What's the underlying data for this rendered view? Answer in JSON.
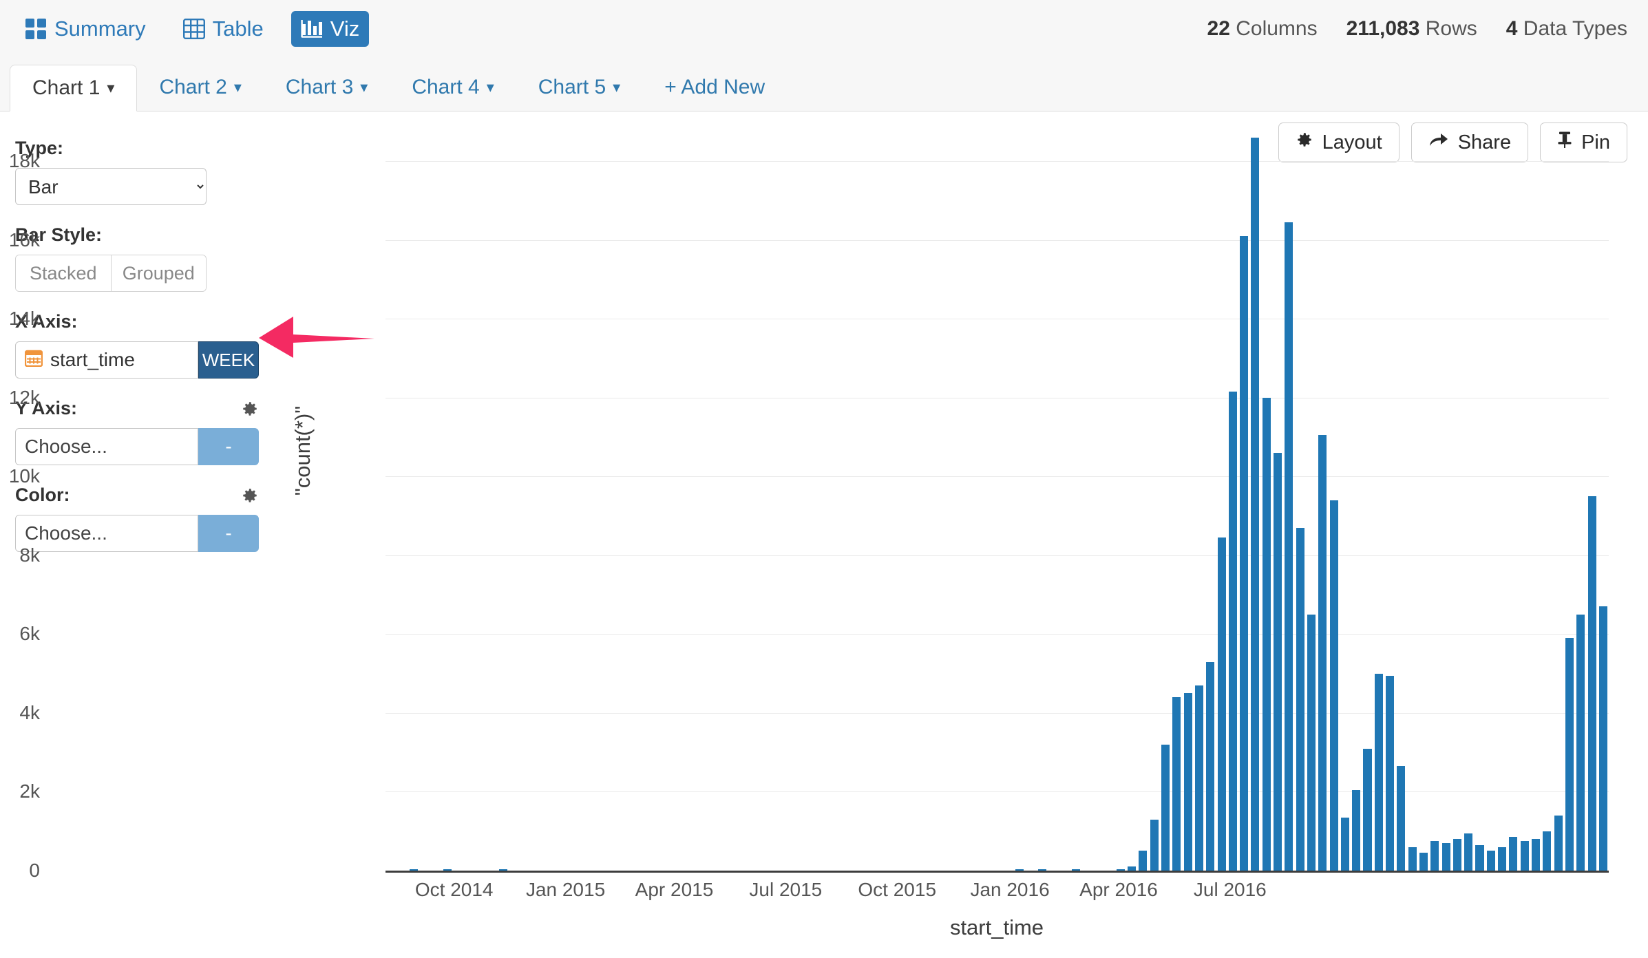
{
  "topbar": {
    "modes": [
      {
        "label": "Summary",
        "icon": "grid-icon",
        "active": false
      },
      {
        "label": "Table",
        "icon": "table-icon",
        "active": false
      },
      {
        "label": "Viz",
        "icon": "bar-chart-icon",
        "active": true
      }
    ],
    "stats": [
      {
        "value": "22",
        "label": "Columns"
      },
      {
        "value": "211,083",
        "label": "Rows"
      },
      {
        "value": "4",
        "label": "Data Types"
      }
    ]
  },
  "tabs": {
    "items": [
      {
        "label": "Chart 1",
        "active": true
      },
      {
        "label": "Chart 2",
        "active": false
      },
      {
        "label": "Chart 3",
        "active": false
      },
      {
        "label": "Chart 4",
        "active": false
      },
      {
        "label": "Chart 5",
        "active": false
      }
    ],
    "add_new_label": "+ Add New",
    "caret": "▾"
  },
  "panel": {
    "type_label": "Type:",
    "type_value": "Bar",
    "type_options": [
      "Bar"
    ],
    "bar_style_label": "Bar Style:",
    "bar_style_options": [
      "Stacked",
      "Grouped"
    ],
    "x_axis_label": "X Axis:",
    "x_axis_field": "start_time",
    "x_axis_field_icon": "calendar-icon",
    "x_axis_pill": "WEEK",
    "y_axis_label": "Y Axis:",
    "y_axis_field": "Choose...",
    "y_axis_pill": "-",
    "color_label": "Color:",
    "color_field": "Choose...",
    "color_pill": "-",
    "gear_icon": "gear-icon"
  },
  "actions": [
    {
      "label": "Layout",
      "icon": "gear-icon"
    },
    {
      "label": "Share",
      "icon": "share-arrow-icon"
    },
    {
      "label": "Pin",
      "icon": "pin-icon"
    }
  ],
  "annotation": {
    "type": "arrow",
    "direction": "left",
    "color": "#F42A62",
    "points_to": "x-axis-week-pill"
  },
  "colors": {
    "bar": "#1f77b4",
    "accent": "#2e7ab8",
    "pill_week": "#2a5f8f",
    "pill_dash": "#7aaed8",
    "annotation": "#F42A62"
  },
  "chart_data": {
    "type": "bar",
    "title": "",
    "xlabel": "start_time",
    "ylabel": "\"count(*)\"",
    "grid": true,
    "legend": null,
    "ylim": [
      0,
      18600
    ],
    "yticks": [
      0,
      2000,
      4000,
      6000,
      8000,
      10000,
      12000,
      14000,
      16000,
      18000
    ],
    "ytick_labels": [
      "0",
      "2k",
      "4k",
      "6k",
      "8k",
      "10k",
      "12k",
      "14k",
      "16k",
      "18k"
    ],
    "xticks": [
      "Oct 2014",
      "Jan 2015",
      "Apr 2015",
      "Jul 2015",
      "Oct 2015",
      "Jan 2016",
      "Apr 2016",
      "Jul 2016"
    ],
    "xtick_positions": [
      0.0505,
      0.1325,
      0.2125,
      0.2945,
      0.3765,
      0.4595,
      0.5395,
      0.6215
    ],
    "x_unit": "week",
    "series": [
      {
        "name": "count(*)",
        "values": [
          0,
          0,
          40,
          0,
          0,
          30,
          0,
          0,
          0,
          0,
          35,
          0,
          0,
          0,
          0,
          0,
          0,
          0,
          0,
          0,
          0,
          0,
          0,
          0,
          0,
          0,
          0,
          0,
          0,
          0,
          0,
          0,
          0,
          0,
          0,
          0,
          0,
          0,
          0,
          0,
          0,
          0,
          0,
          0,
          0,
          0,
          0,
          0,
          0,
          0,
          0,
          0,
          0,
          0,
          0,
          0,
          30,
          0,
          35,
          0,
          0,
          30,
          0,
          0,
          0,
          40,
          100,
          500,
          1300,
          3200,
          4400,
          4500,
          4700,
          5300,
          8450,
          12150,
          16100,
          18600,
          12000,
          10600,
          16450,
          8700,
          6500,
          11050,
          9400,
          1350,
          2050,
          3100,
          5000,
          4950,
          2650,
          600,
          450,
          750,
          700,
          800,
          950,
          650,
          500,
          600,
          850,
          750,
          800,
          1000,
          1400,
          5900,
          6500,
          9500,
          6700
        ]
      }
    ]
  }
}
